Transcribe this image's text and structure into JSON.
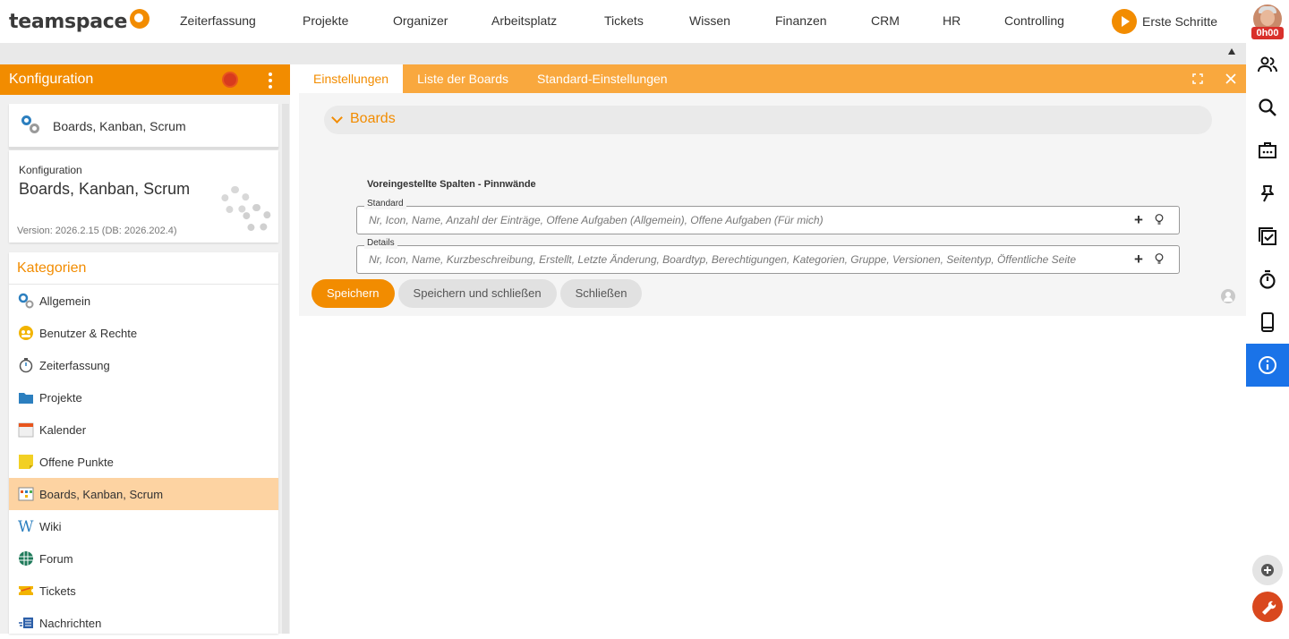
{
  "brand": {
    "name": "teamspace"
  },
  "nav": [
    "Zeiterfassung",
    "Projekte",
    "Organizer",
    "Arbeitsplatz",
    "Tickets",
    "Wissen",
    "Finanzen",
    "CRM",
    "HR",
    "Controlling"
  ],
  "erste_schritte": "Erste Schritte",
  "timer": "0h00",
  "left_panel": {
    "title": "Konfiguration",
    "selected_card": "Boards, Kanban, Scrum",
    "info": {
      "small_label": "Konfiguration",
      "title": "Boards, Kanban, Scrum",
      "version": "Version: 2026.2.15 (DB: 2026.202.4)"
    },
    "categories_title": "Kategorien",
    "categories": [
      {
        "label": "Allgemein",
        "icon": "gears-icon"
      },
      {
        "label": "Benutzer & Rechte",
        "icon": "users-icon"
      },
      {
        "label": "Zeiterfassung",
        "icon": "stopwatch-icon"
      },
      {
        "label": "Projekte",
        "icon": "folder-icon"
      },
      {
        "label": "Kalender",
        "icon": "calendar-icon"
      },
      {
        "label": "Offene Punkte",
        "icon": "sticky-note-icon"
      },
      {
        "label": "Boards, Kanban, Scrum",
        "icon": "board-icon"
      },
      {
        "label": "Wiki",
        "icon": "wiki-icon"
      },
      {
        "label": "Forum",
        "icon": "forum-icon"
      },
      {
        "label": "Tickets",
        "icon": "ticket-icon"
      },
      {
        "label": "Nachrichten",
        "icon": "messages-icon"
      }
    ]
  },
  "tabs": [
    "Einstellungen",
    "Liste der Boards",
    "Standard-Einstellungen"
  ],
  "form": {
    "section_title": "Boards",
    "subhead": "Voreingestellte Spalten - Pinnwände",
    "fields": [
      {
        "legend": "Standard",
        "value": "Nr, Icon, Name, Anzahl der Einträge, Offene Aufgaben (Allgemein), Offene Aufgaben (Für mich)"
      },
      {
        "legend": "Details",
        "value": "Nr, Icon, Name, Kurzbeschreibung, Erstellt, Letzte Änderung, Boardtyp, Berechtigungen, Kategorien, Gruppe, Versionen, Seitentyp, Öffentliche Seite"
      }
    ],
    "buttons": {
      "save": "Speichern",
      "save_close": "Speichern und schließen",
      "close": "Schließen"
    }
  },
  "colors": {
    "accent": "#f28c00",
    "tab_bar": "#f9a83e",
    "active_category": "#fdd3a2",
    "info_active": "#1a73e8",
    "tools_button": "#d9481e"
  }
}
